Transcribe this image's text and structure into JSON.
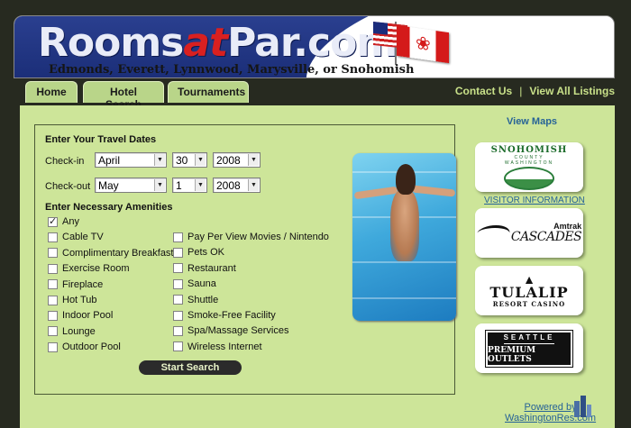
{
  "header": {
    "logo_part1": "Rooms",
    "logo_part2": "at",
    "logo_part3": "Par.com",
    "cities": "Edmonds, Everett, Lynnwood, Marysville, or Snohomish"
  },
  "nav": {
    "tabs": [
      {
        "label": "Home"
      },
      {
        "label": "Hotel Search"
      },
      {
        "label": "Tournaments"
      }
    ],
    "links": [
      {
        "label": "Contact Us"
      },
      {
        "label": "View All Listings"
      }
    ],
    "separator": "|"
  },
  "search": {
    "dates_title": "Enter Your Travel Dates",
    "checkin_label": "Check-in",
    "checkout_label": "Check-out",
    "checkin": {
      "month": "April",
      "day": "30",
      "year": "2008"
    },
    "checkout": {
      "month": "May",
      "day": "1",
      "year": "2008"
    },
    "amenities_title": "Enter Necessary Amenities",
    "amenities_left": [
      {
        "label": "Any",
        "checked": true
      },
      {
        "label": "Cable TV",
        "checked": false
      },
      {
        "label": "Complimentary Breakfast",
        "checked": false
      },
      {
        "label": "Exercise Room",
        "checked": false
      },
      {
        "label": "Fireplace",
        "checked": false
      },
      {
        "label": "Hot Tub",
        "checked": false
      },
      {
        "label": "Indoor Pool",
        "checked": false
      },
      {
        "label": "Lounge",
        "checked": false
      },
      {
        "label": "Outdoor Pool",
        "checked": false
      }
    ],
    "amenities_right": [
      {
        "label": "Pay Per View Movies / Nintendo",
        "checked": false
      },
      {
        "label": "Pets OK",
        "checked": false
      },
      {
        "label": "Restaurant",
        "checked": false
      },
      {
        "label": "Sauna",
        "checked": false
      },
      {
        "label": "Shuttle",
        "checked": false
      },
      {
        "label": "Smoke-Free Facility",
        "checked": false
      },
      {
        "label": "Spa/Massage Services",
        "checked": false
      },
      {
        "label": "Wireless Internet",
        "checked": false
      }
    ],
    "submit_label": "Start Search"
  },
  "sidebar": {
    "view_maps": "View Maps",
    "visitor_info": "VISITOR INFORMATION",
    "ads": {
      "snohomish_title": "SNOHOMISH",
      "snohomish_sub1": "COUNTY",
      "snohomish_sub2": "WASHINGTON",
      "amtrak_top": "Amtrak",
      "amtrak_bottom": "CASCADES",
      "tulalip_name": "TULALIP",
      "tulalip_sub": "RESORT CASINO",
      "seattle_top": "SEATTLE",
      "seattle_bottom": "PREMIUM OUTLETS"
    },
    "powered_line1": "Powered by",
    "powered_line2": "WashingtonRes.com"
  },
  "colors": {
    "page_bg": "#272a20",
    "main_bg": "#cde599",
    "tab_bg": "#b9d589",
    "link_blue": "#276397",
    "logo_blue": "#1b2e78",
    "logo_red": "#d92020"
  }
}
